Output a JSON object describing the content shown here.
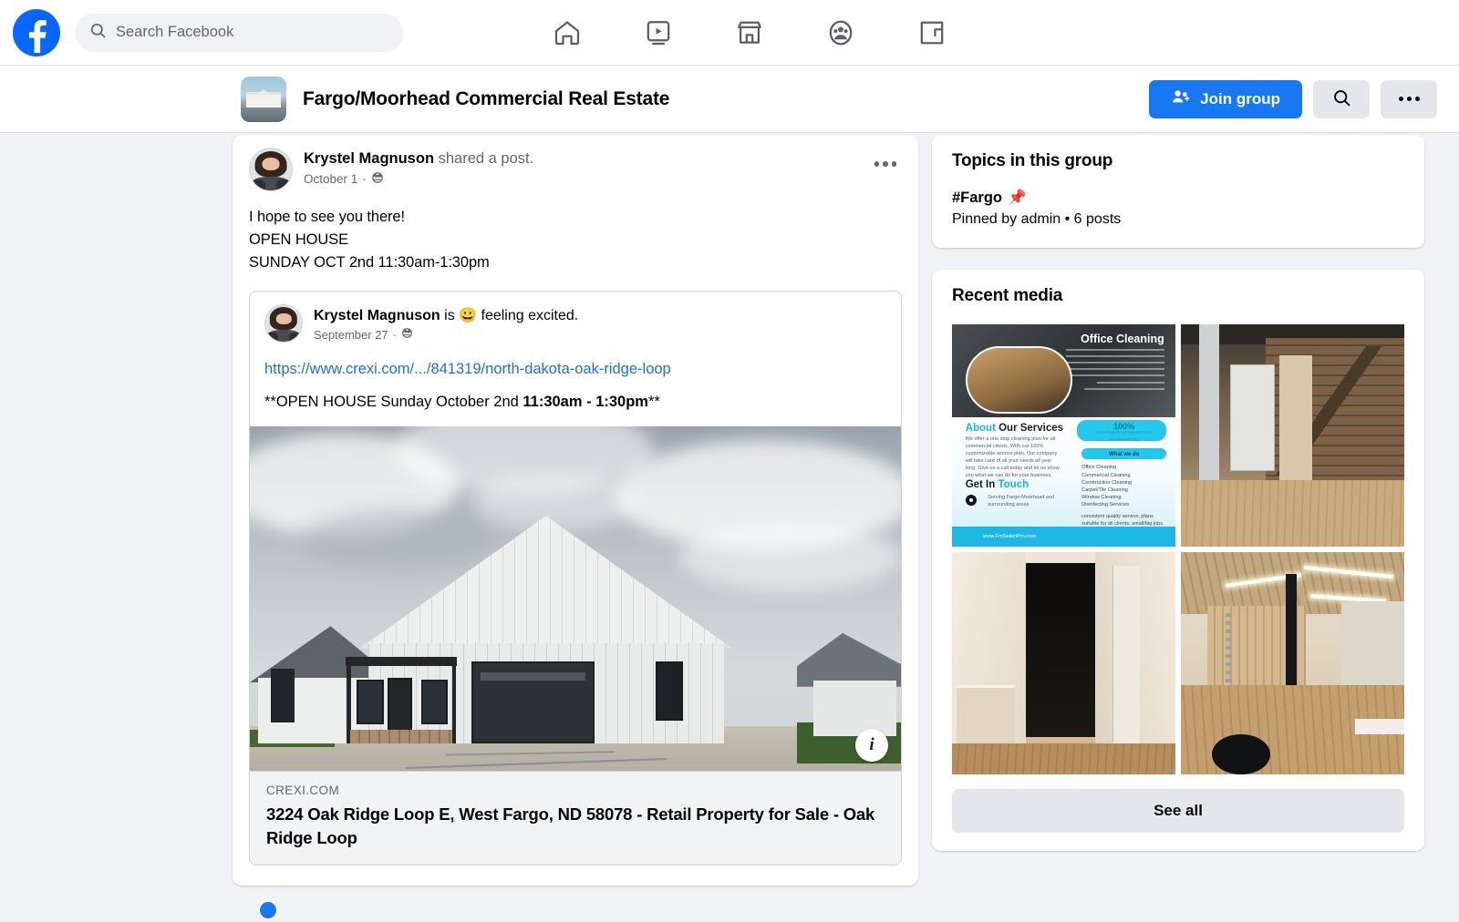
{
  "topnav": {
    "logo": "facebook-logo",
    "search": {
      "placeholder": "Search Facebook",
      "value": ""
    },
    "items": [
      {
        "name": "home",
        "icon": "home-icon"
      },
      {
        "name": "video",
        "icon": "video-icon"
      },
      {
        "name": "marketplace",
        "icon": "marketplace-icon"
      },
      {
        "name": "groups",
        "icon": "groups-icon"
      },
      {
        "name": "gaming",
        "icon": "gaming-icon"
      }
    ]
  },
  "group_header": {
    "name": "Fargo/Moorhead Commercial Real Estate",
    "join_label": "Join group",
    "search_icon": "search-icon",
    "more_icon": "more-horizontal-icon"
  },
  "post": {
    "author": "Krystel Magnuson",
    "action": " shared a post.",
    "date": "October 1",
    "privacy_icon": "globe-icon",
    "menu_icon": "more-horizontal-icon",
    "body": "I hope to see you there!\nOPEN HOUSE\nSUNDAY OCT 2nd 11:30am-1:30pm",
    "shared": {
      "author": "Krystel Magnuson",
      "action_pre": " is ",
      "emoji": "😀",
      "action_post": " feeling excited.",
      "date": "September 27",
      "privacy_icon": "globe-icon",
      "link": "https://www.crexi.com/.../841319/north-dakota-oak-ridge-loop",
      "text_plain_1": "**OPEN HOUSE Sunday October 2nd ",
      "text_bold": "11:30am - 1:30pm",
      "text_plain_2": "**",
      "preview": {
        "image_alt": "white-barn-style-retail-building",
        "info_label": "i",
        "domain": "CREXI.COM",
        "title": "3224 Oak Ridge Loop E, West Fargo, ND 58078 - Retail Property for Sale - Oak Ridge Loop"
      }
    }
  },
  "sidebar": {
    "topics": {
      "title": "Topics in this group",
      "items": [
        {
          "name": "#Fargo",
          "pin_icon": "📌",
          "meta": "Pinned by admin • 6 posts"
        }
      ]
    },
    "media": {
      "title": "Recent media",
      "see_all_label": "See all",
      "items": [
        {
          "alt": "office-cleaning-flyer",
          "flyer": {
            "headline": "Office Cleaning",
            "about_cyan": "About",
            "about_rest": " Our Services",
            "about_body": "We offer a one stop cleaning plan for all commercial clients. With our 100% customizable service plan. Our company will take care of all your needs all year long. Give us a call today and let us show you what we can do for your business.",
            "get_in": "Get In ",
            "touch": "Touch",
            "location": "Serving Fargo-Moorhead and surrounding areas",
            "badge": "100%",
            "badge_sub": "CUSTOMER SATISFACTION GUARANTEED",
            "what_we_do": "What we do",
            "services": "Office Cleaning\nCommercial Cleaning\nConstruction Cleaning\nCarpet/Tile Cleaning\nWindow Cleaning\nDisinfecting Services",
            "note": "consistent quality service, plans suitable for all clients, small/big jobs",
            "website": "www.FmSelectPro.com"
          }
        },
        {
          "alt": "interior-barn-door-brick-wall"
        },
        {
          "alt": "interior-hallway-renovation"
        },
        {
          "alt": "open-commercial-space-renovation"
        }
      ]
    }
  }
}
